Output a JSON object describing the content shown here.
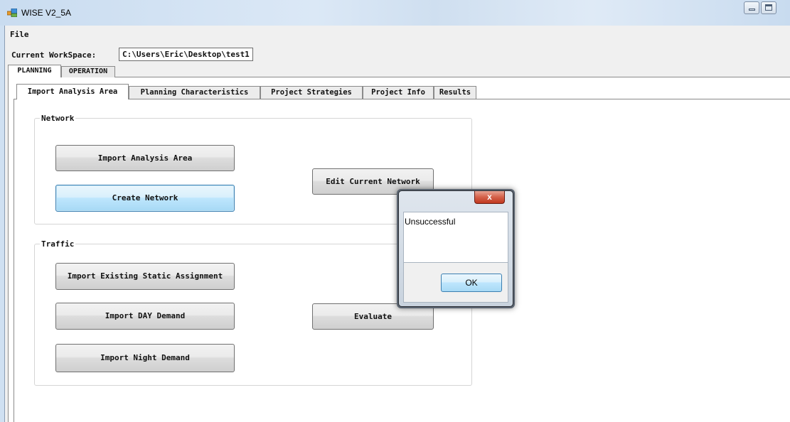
{
  "window": {
    "title": "WISE V2_5A"
  },
  "menu": {
    "file": "File"
  },
  "workspace": {
    "label": "Current WorkSpace:",
    "path": "C:\\Users\\Eric\\Desktop\\test1"
  },
  "tabs": [
    {
      "label": "PLANNING",
      "selected": true
    },
    {
      "label": "OPERATION",
      "selected": false
    }
  ],
  "subtabs": [
    {
      "label": "Import Analysis Area",
      "selected": true
    },
    {
      "label": "Planning Characteristics",
      "selected": false
    },
    {
      "label": "Project Strategies",
      "selected": false
    },
    {
      "label": "Project Info",
      "selected": false
    },
    {
      "label": "Results",
      "selected": false
    }
  ],
  "network_group": {
    "label": "Network",
    "buttons": {
      "import_area": "Import Analysis Area",
      "create_network": "Create Network",
      "edit_network": "Edit Current Network"
    }
  },
  "traffic_group": {
    "label": "Traffic",
    "buttons": {
      "import_static": "Import Existing Static Assignment",
      "import_day": "Import DAY Demand",
      "import_night": "Import Night Demand",
      "evaluate": "Evaluate"
    }
  },
  "dialog": {
    "message": "Unsuccessful",
    "ok_label": "OK",
    "close_glyph": "x"
  },
  "colors": {
    "focus_blue": "#3c7fb1",
    "close_red": "#c0381f",
    "titlebar": "#c9dcf0"
  }
}
